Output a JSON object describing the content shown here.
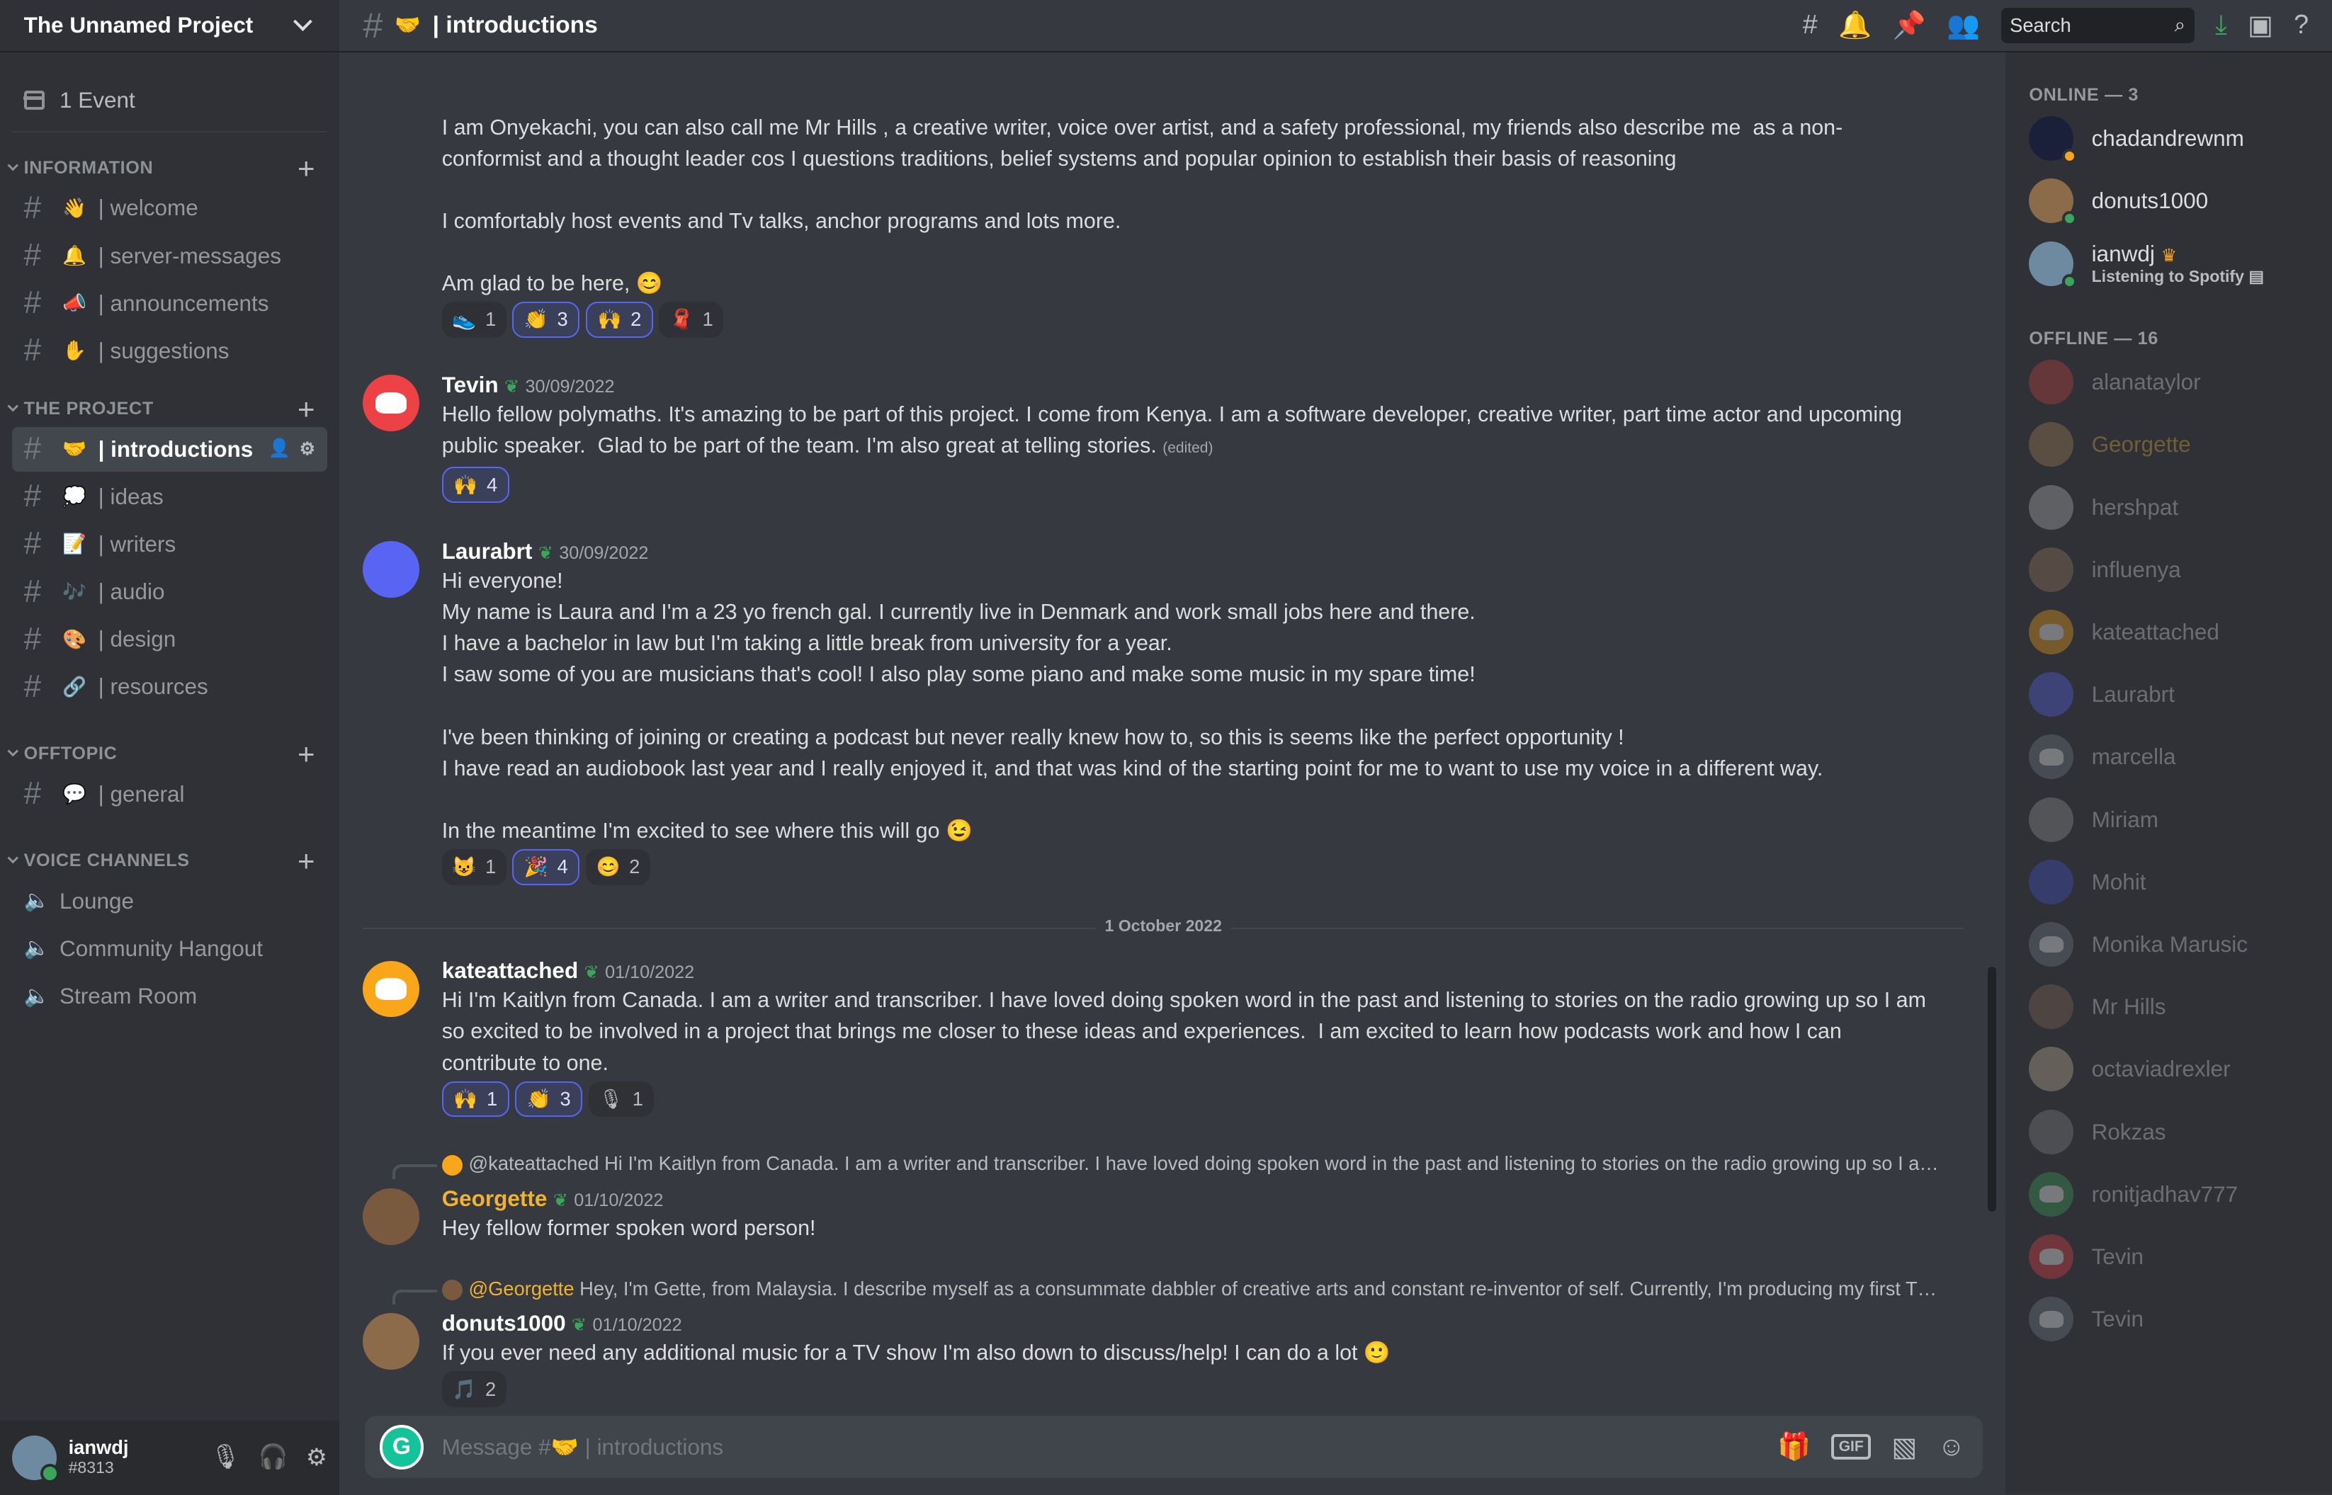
{
  "server": {
    "name": "The Unnamed Project",
    "events": "1 Event"
  },
  "categories": [
    {
      "name": "INFORMATION",
      "channels": [
        {
          "emoji": "👋",
          "name": "| welcome"
        },
        {
          "emoji": "🔔",
          "name": "| server-messages"
        },
        {
          "emoji": "📣",
          "name": "| announcements"
        },
        {
          "emoji": "✋",
          "name": "| suggestions"
        }
      ]
    },
    {
      "name": "THE PROJECT",
      "channels": [
        {
          "emoji": "🤝",
          "name": "| introductions"
        },
        {
          "emoji": "💭",
          "name": "| ideas"
        },
        {
          "emoji": "📝",
          "name": "| writers"
        },
        {
          "emoji": "🎶",
          "name": "| audio"
        },
        {
          "emoji": "🎨",
          "name": "| design"
        },
        {
          "emoji": "🔗",
          "name": "| resources"
        }
      ]
    },
    {
      "name": "OFFTOPIC",
      "channels": [
        {
          "emoji": "💬",
          "name": "| general"
        }
      ]
    },
    {
      "name": "VOICE CHANNELS",
      "channels": [
        {
          "name": "Lounge"
        },
        {
          "name": "Community Hangout"
        },
        {
          "name": "Stream Room"
        }
      ]
    }
  ],
  "user": {
    "name": "ianwdj",
    "tag": "#8313"
  },
  "topbar": {
    "emoji": "🤝",
    "title": "| introductions",
    "search": "Search"
  },
  "messages": [
    {
      "text": "I am Onyekachi, you can also call me Mr Hills , a creative writer, voice over artist, and a safety professional, my friends also describe me  as a non-conformist and a thought leader cos I questions traditions, belief systems and popular opinion to establish their basis of reasoning\n\nI comfortably host events and Tv talks, anchor programs and lots more.\n\nAm glad to be here, 😊",
      "reactions": [
        {
          "emoji": "👟",
          "count": "1"
        },
        {
          "emoji": "👏",
          "count": "3"
        },
        {
          "emoji": "🙌",
          "count": "2"
        },
        {
          "emoji": "🧣",
          "count": "1"
        }
      ]
    },
    {
      "author": "Tevin",
      "time": "30/09/2022",
      "text": "Hello fellow polymaths. It's amazing to be part of this project. I come from Kenya. I am a software developer, creative writer, part time actor and upcoming public speaker.  Glad to be part of the team. I'm also great at telling stories.",
      "edited": "(edited)",
      "reactions": [
        {
          "emoji": "🙌",
          "count": "4"
        }
      ]
    },
    {
      "author": "Laurabrt",
      "time": "30/09/2022",
      "text": "Hi everyone!\nMy name is Laura and I'm a 23 yo french gal. I currently live in Denmark and work small jobs here and there.\nI have a bachelor in law but I'm taking a little break from university for a year.\nI saw some of you are musicians that's cool! I also play some piano and make some music in my spare time!\n\nI've been thinking of joining or creating a podcast but never really knew how to, so this is seems like the perfect opportunity !\nI have read an audiobook last year and I really enjoyed it, and that was kind of the starting point for me to want to use my voice in a different way.\n\nIn the meantime I'm excited to see where this will go 😉",
      "reactions": [
        {
          "emoji": "😺",
          "count": "1"
        },
        {
          "emoji": "🎉",
          "count": "4"
        },
        {
          "emoji": "😊",
          "count": "2"
        }
      ]
    },
    {
      "author": "kateattached",
      "time": "01/10/2022",
      "text": "Hi I'm Kaitlyn from Canada. I am a writer and transcriber. I have loved doing spoken word in the past and listening to stories on the radio growing up so I am so excited to be involved in a project that brings me closer to these ideas and experiences.  I am excited to learn how podcasts work and how I can contribute to one.",
      "reactions": [
        {
          "emoji": "🙌",
          "count": "1"
        },
        {
          "emoji": "👏",
          "count": "3"
        },
        {
          "emoji": "🎙",
          "count": "1"
        }
      ]
    },
    {
      "author": "Georgette",
      "time": "01/10/2022",
      "reply_to": "@kateattached",
      "reply_text": "Hi I'm Kaitlyn from Canada. I am a writer and transcriber. I have loved doing spoken word in the past and listening to stories on the radio growing up so I am so ...",
      "text": "Hey fellow former spoken word person!"
    },
    {
      "author": "donuts1000",
      "time": "01/10/2022",
      "reply_to": "@Georgette",
      "reply_text": "Hey, I'm Gette, from Malaysia. I describe myself as a consummate dabbler of creative arts and constant re-inventor of self. Currently, I'm producing my first TV sh...",
      "text": "If you ever need any additional music for a TV show I'm also down to discuss/help! I can do a lot 🙂",
      "reactions": [
        {
          "emoji": "🎵",
          "count": "2"
        }
      ]
    }
  ],
  "date_divider": "1 October 2022",
  "badge_icon": "sprout-icon",
  "composer": {
    "placeholder_prefix": "Message #🤝",
    "placeholder_channel": "| introductions",
    "grammarly": "G"
  },
  "members": {
    "online_header": "ONLINE — 3",
    "online": [
      {
        "name": "chadandrewnm"
      },
      {
        "name": "donuts1000"
      },
      {
        "name": "ianwdj",
        "activity": "Listening to Spotify"
      }
    ],
    "offline_header": "OFFLINE — 16",
    "offline": [
      "alanataylor",
      "Georgette",
      "hershpat",
      "influenya",
      "kateattached",
      "Laurabrt",
      "marcella",
      "Miriam",
      "Mohit",
      "Monika Marusic",
      "Mr Hills",
      "octaviadrexler",
      "Rokzas",
      "ronitjadhav777",
      "Tevin",
      "Tevin"
    ]
  },
  "colors": {
    "accent": "#5865f2",
    "online": "#3ba55c",
    "georgette": "#f0b232",
    "background": "#36393f",
    "sidebar": "#2f3136"
  }
}
